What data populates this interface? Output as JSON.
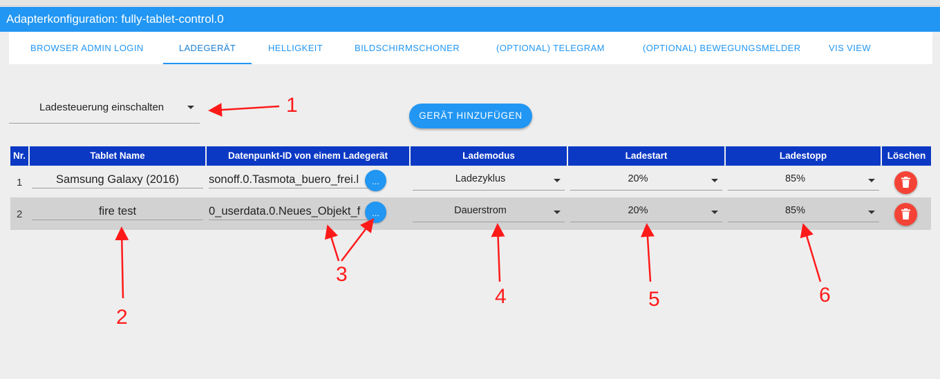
{
  "window": {
    "title": "Adapterkonfiguration: fully-tablet-control.0"
  },
  "tabs": [
    {
      "label": "BROWSER ADMIN LOGIN"
    },
    {
      "label": "LADEGERÄT",
      "active": true
    },
    {
      "label": "HELLIGKEIT"
    },
    {
      "label": "BILDSCHIRMSCHONER"
    },
    {
      "label": "(OPTIONAL) TELEGRAM"
    },
    {
      "label": "(OPTIONAL) BEWEGUNGSMELDER"
    },
    {
      "label": "VIS VIEW"
    }
  ],
  "charge_control": {
    "selected": "Ladesteuerung einschalten"
  },
  "add_button": {
    "label": "GERÄT HINZUFÜGEN"
  },
  "table": {
    "headers": [
      "Nr.",
      "Tablet Name",
      "Datenpunkt-ID von einem Ladegerät",
      "Lademodus",
      "Ladestart",
      "Ladestopp",
      "Löschen"
    ],
    "rows": [
      {
        "nr": "1",
        "name": "Samsung Galaxy (2016)",
        "id": "sonoff.0.Tasmota_buero_frei.l",
        "browse": "...",
        "mode": "Ladezyklus",
        "start": "20%",
        "stop": "85%"
      },
      {
        "nr": "2",
        "name": "fire test",
        "id": "0_userdata.0.Neues_Objekt_f",
        "browse": "...",
        "mode": "Dauerstrom",
        "start": "20%",
        "stop": "85%"
      }
    ]
  },
  "annotations": {
    "a1": "1",
    "a2": "2",
    "a3": "3",
    "a4": "4",
    "a5": "5",
    "a6": "6"
  },
  "colors": {
    "primary": "#2196f3",
    "header": "#0b39c4",
    "delete": "#f44336",
    "annotation": "#ff1a1a"
  },
  "icons": {
    "caret": "chevron-down-icon",
    "delete": "trash-icon"
  }
}
